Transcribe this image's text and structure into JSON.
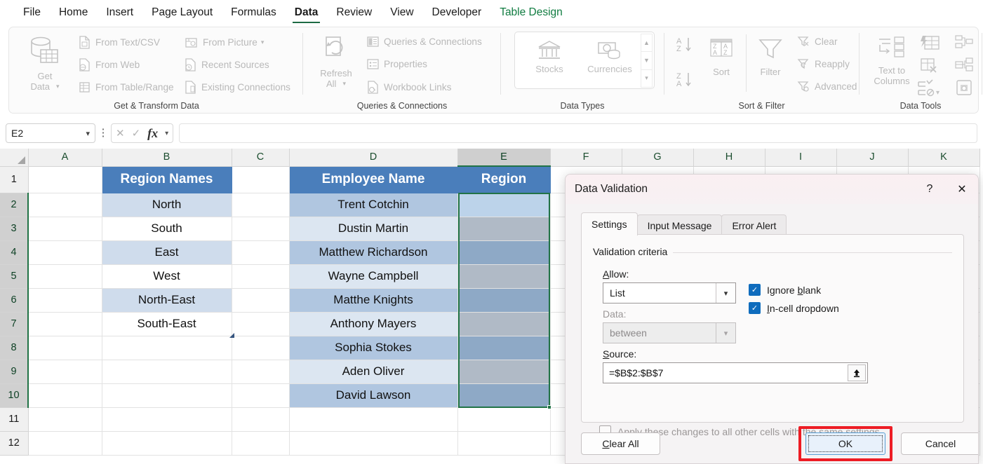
{
  "ribbon": {
    "tabs": [
      {
        "label": "File",
        "state": "normal"
      },
      {
        "label": "Home",
        "state": "normal"
      },
      {
        "label": "Insert",
        "state": "normal"
      },
      {
        "label": "Page Layout",
        "state": "normal"
      },
      {
        "label": "Formulas",
        "state": "normal"
      },
      {
        "label": "Data",
        "state": "active"
      },
      {
        "label": "Review",
        "state": "normal"
      },
      {
        "label": "View",
        "state": "normal"
      },
      {
        "label": "Developer",
        "state": "normal"
      },
      {
        "label": "Table Design",
        "state": "contextual"
      }
    ],
    "groups": {
      "get_transform": {
        "label": "Get & Transform Data",
        "get_data": "Get\nData",
        "get_data_line1": "Get",
        "get_data_line2": "Data",
        "items": [
          "From Text/CSV",
          "From Web",
          "From Table/Range",
          "From Picture",
          "Recent Sources",
          "Existing Connections"
        ]
      },
      "queries": {
        "label": "Queries & Connections",
        "refresh_line1": "Refresh",
        "refresh_line2": "All",
        "items": [
          "Queries & Connections",
          "Properties",
          "Workbook Links"
        ]
      },
      "data_types": {
        "label": "Data Types",
        "items": [
          "Stocks",
          "Currencies"
        ]
      },
      "sort_filter": {
        "label": "Sort & Filter",
        "sort": "Sort",
        "filter": "Filter",
        "items": [
          "Clear",
          "Reapply",
          "Advanced"
        ]
      },
      "data_tools": {
        "label": "Data Tools",
        "text_to_columns_line1": "Text to",
        "text_to_columns_line2": "Columns"
      }
    }
  },
  "formula_bar": {
    "name_box_value": "E2",
    "formula_value": ""
  },
  "sheet": {
    "column_headers": [
      "A",
      "B",
      "C",
      "D",
      "E",
      "F",
      "G",
      "H",
      "I",
      "J",
      "K"
    ],
    "selected_column": "E",
    "row_headers": [
      "1",
      "2",
      "3",
      "4",
      "5",
      "6",
      "7",
      "8",
      "9",
      "10",
      "11",
      "12"
    ],
    "selected_rows": [
      "2",
      "3",
      "4",
      "5",
      "6",
      "7",
      "8",
      "9",
      "10"
    ],
    "table_b": {
      "header": "Region Names",
      "values": [
        "North",
        "South",
        "East",
        "West",
        "North-East",
        "South-East"
      ]
    },
    "table_d": {
      "header": "Employee Name",
      "values": [
        "Trent Cotchin",
        "Dustin Martin",
        "Matthew Richardson",
        "Wayne Campbell",
        "Matthe Knights",
        "Anthony Mayers",
        "Sophia Stokes",
        "Aden Oliver",
        "David Lawson"
      ]
    },
    "table_e": {
      "header": "Region",
      "values": [
        "",
        "",
        "",
        "",
        "",
        "",
        "",
        "",
        ""
      ]
    }
  },
  "dialog": {
    "title": "Data Validation",
    "help_label": "?",
    "close_label": "✕",
    "tabs": [
      {
        "label": "Settings",
        "active": true
      },
      {
        "label": "Input Message",
        "active": false
      },
      {
        "label": "Error Alert",
        "active": false
      }
    ],
    "group_label": "Validation criteria",
    "allow_label": "Allow:",
    "allow_value": "List",
    "data_label": "Data:",
    "data_value": "between",
    "source_label": "Source:",
    "source_value": "=$B$2:$B$7",
    "ignore_blank_label": "Ignore blank",
    "ignore_blank_checked": true,
    "in_cell_dropdown_label": "In-cell dropdown",
    "in_cell_dropdown_checked": true,
    "apply_all_label": "Apply these changes to all other cells with the same settings",
    "apply_all_checked": false,
    "clear_all_label": "Clear All",
    "ok_label": "OK",
    "cancel_label": "Cancel",
    "highlight_color": "#ed1c24"
  }
}
